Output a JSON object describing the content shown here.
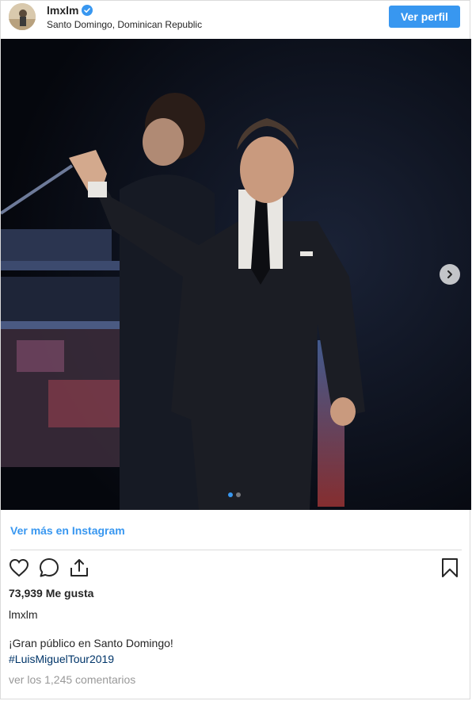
{
  "post": {
    "username": "lmxlm",
    "location": "Santo Domingo, Dominican Republic",
    "view_profile_label": "Ver perfil",
    "more_link": "Ver más en Instagram",
    "likes": "73,939 Me gusta",
    "caption_user": "lmxlm",
    "caption_text": "¡Gran público en Santo Domingo!",
    "hashtag": "#LuisMiguelTour2019",
    "comments_link": "ver los 1,245 comentarios",
    "carousel": {
      "total": 2,
      "current": 1
    }
  },
  "icons": {
    "verified": "verified-badge-icon",
    "next": "chevron-right-icon",
    "like": "heart-icon",
    "comment": "comment-icon",
    "share": "share-icon",
    "save": "bookmark-icon"
  },
  "colors": {
    "accent": "#3897f0",
    "hashtag": "#003569",
    "muted": "#999999",
    "text": "#262626"
  }
}
